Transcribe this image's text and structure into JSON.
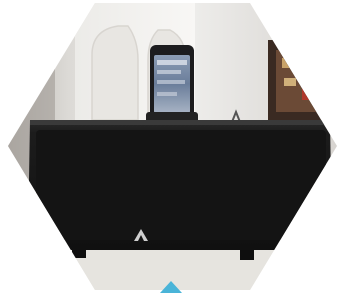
{
  "photo": {
    "subject": "speaker-dock-with-phone",
    "colors": {
      "background": "#ffffff",
      "wall": "#e4e2df",
      "speaker_body": "#191919",
      "speaker_grille": "#121212",
      "table": "#e9e7e2",
      "phone": "#1c1c1e",
      "phone_screen": "#7e8fa8",
      "accent_marker": "#4ab4d8"
    }
  }
}
